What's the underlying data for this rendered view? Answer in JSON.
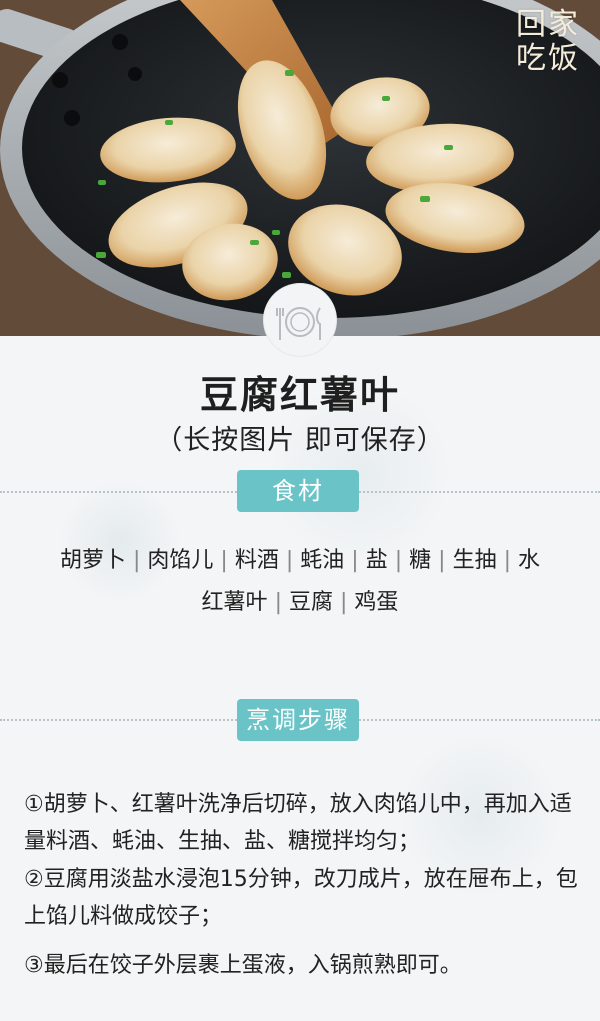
{
  "brand": {
    "line1": "回家",
    "line2": "吃饭"
  },
  "recipe": {
    "title": "豆腐红薯叶",
    "subtitle": "（长按图片  即可保存）"
  },
  "sections": {
    "ingredients_label": "食材",
    "steps_label": "烹调步骤"
  },
  "ingredients": {
    "line1": [
      "胡萝卜",
      "肉馅儿",
      "料酒",
      "蚝油",
      "盐",
      "糖",
      "生抽",
      "水"
    ],
    "line2": [
      "红薯叶",
      "豆腐",
      "鸡蛋"
    ]
  },
  "steps": [
    "①胡萝卜、红薯叶洗净后切碎，放入肉馅儿中，再加入适量料酒、蚝油、生抽、盐、糖搅拌均匀；",
    "②豆腐用淡盐水浸泡15分钟，改刀成片，放在屉布上，包上馅儿料做成饺子；",
    "③最后在饺子外层裹上蛋液，入锅煎熟即可。"
  ],
  "icons": {
    "hero": "dumplings-in-pan-photo",
    "badge": "plate-fork-knife-icon"
  },
  "colors": {
    "accent": "#6ac4c7",
    "paper": "#f3f5f6",
    "text": "#222222"
  }
}
